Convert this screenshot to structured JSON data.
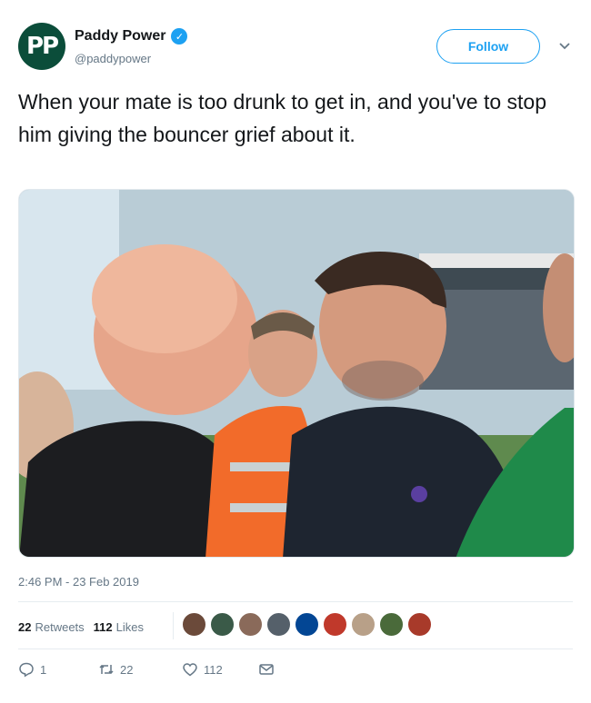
{
  "account": {
    "avatar_text": "PP",
    "display_name": "Paddy Power",
    "handle": "@paddypower",
    "verified": true,
    "verified_glyph": "✓"
  },
  "follow_label": "Follow",
  "tweet_text": "When your mate is too drunk to get in, and you've to stop him giving the bouncer grief about it.",
  "timestamp": "2:46 PM - 23 Feb 2019",
  "stats": {
    "retweets_count": "22",
    "retweets_label": "Retweets",
    "likes_count": "112",
    "likes_label": "Likes"
  },
  "liker_avatar_colors": [
    "#6b4a3a",
    "#3a5a48",
    "#8a6a5a",
    "#55606a",
    "#034694",
    "#c0392b",
    "#b8a088",
    "#4a6a3a",
    "#a83a2a"
  ],
  "actions": {
    "reply_count": "1",
    "retweet_count": "22",
    "like_count": "112"
  },
  "colors": {
    "brand_green": "#0b4d3a",
    "twitter_blue": "#1da1f2",
    "secondary_text": "#657786"
  },
  "icons": [
    "chevron-down-icon",
    "verified-badge-icon",
    "reply-icon",
    "retweet-icon",
    "like-icon",
    "direct-message-icon"
  ]
}
